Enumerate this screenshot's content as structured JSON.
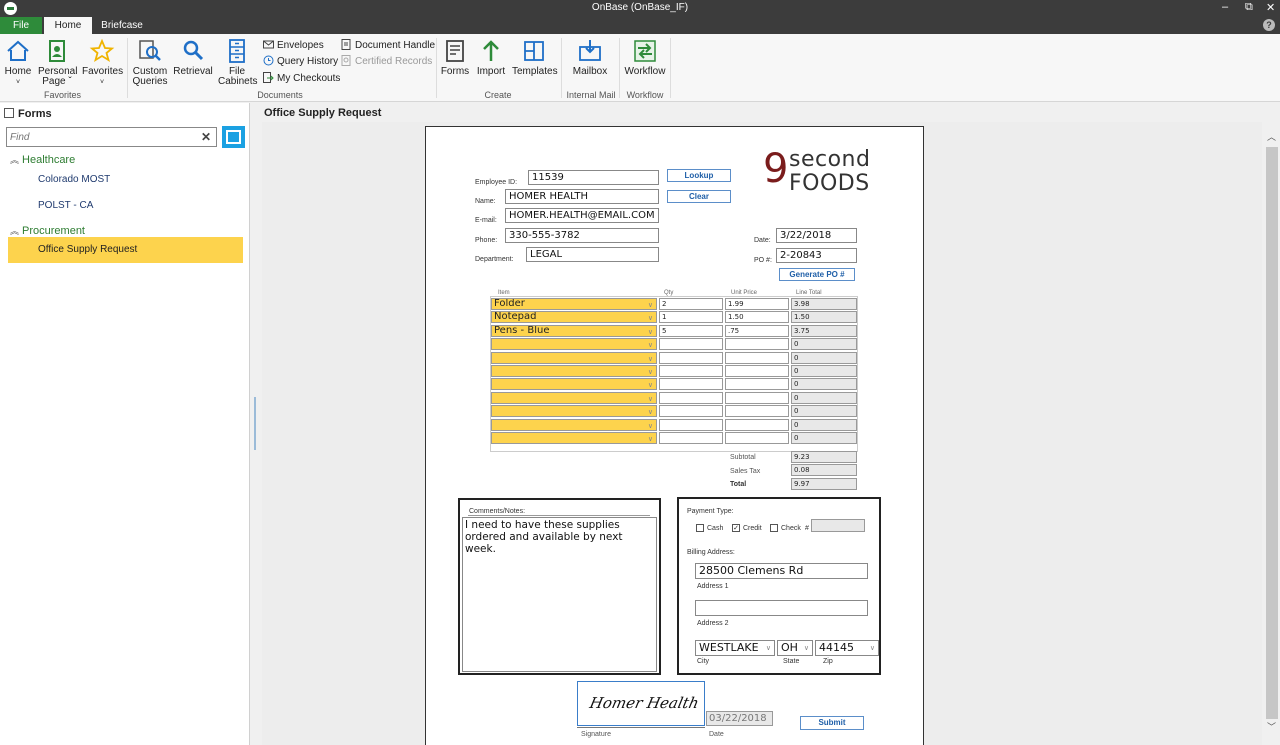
{
  "window": {
    "title": "OnBase (OnBase_IF)",
    "minimize": "–",
    "restore": "⧉",
    "close": "✕",
    "help": "?"
  },
  "tabs": [
    "File",
    "Home",
    "Briefcase"
  ],
  "ribbon": {
    "favorites": {
      "home": "Home",
      "personal_page_1": "Personal",
      "personal_page_2": "Page ˇ",
      "favorites": "Favorites",
      "group": "Favorites"
    },
    "documents": {
      "custom_queries_1": "Custom",
      "custom_queries_2": "Queries",
      "retrieval": "Retrieval",
      "file_cabinets_1": "File",
      "file_cabinets_2": "Cabinets",
      "envelopes": "Envelopes",
      "query_history": "Query History",
      "my_checkouts": "My Checkouts",
      "document_handle": "Document Handle",
      "certified_records": "Certified Records",
      "group": "Documents"
    },
    "create": {
      "forms": "Forms",
      "import": "Import",
      "templates": "Templates",
      "group": "Create"
    },
    "internal_mail": {
      "mailbox": "Mailbox",
      "group": "Internal Mail"
    },
    "workflow": {
      "workflow": "Workflow",
      "group": "Workflow"
    }
  },
  "sidebar": {
    "title": "Forms",
    "find_placeholder": "Find",
    "categories": [
      {
        "label": "Healthcare",
        "items": [
          "Colorado MOST",
          "POLST - CA"
        ]
      },
      {
        "label": "Procurement",
        "items": [
          "Office Supply Request"
        ]
      }
    ]
  },
  "main": {
    "title": "Office Supply Request"
  },
  "form": {
    "brand": {
      "line1": "second",
      "line2": "FOODS",
      "digit": "9"
    },
    "labels": {
      "employee_id": "Employee ID:",
      "name": "Name:",
      "email": "E-mail:",
      "phone": "Phone:",
      "department": "Department:",
      "date": "Date:",
      "po": "PO #:"
    },
    "values": {
      "employee_id": "11539",
      "name": "HOMER HEALTH",
      "email": "HOMER.HEALTH@EMAIL.COM",
      "phone": "330-555-3782",
      "department": "LEGAL",
      "date": "3/22/2018",
      "po": "2-20843"
    },
    "buttons": {
      "lookup": "Lookup",
      "clear": "Clear",
      "generate_po": "Generate PO #",
      "submit": "Submit"
    },
    "table": {
      "headers": [
        "Item",
        "Qty",
        "Unit Price",
        "Line Total"
      ],
      "rows": [
        {
          "item": "Folder",
          "qty": "2",
          "price": "1.99",
          "total": "3.98"
        },
        {
          "item": "Notepad",
          "qty": "1",
          "price": "1.50",
          "total": "1.50"
        },
        {
          "item": "Pens - Blue",
          "qty": "5",
          "price": ".75",
          "total": "3.75"
        },
        {
          "item": "",
          "qty": "",
          "price": "",
          "total": "0"
        },
        {
          "item": "",
          "qty": "",
          "price": "",
          "total": "0"
        },
        {
          "item": "",
          "qty": "",
          "price": "",
          "total": "0"
        },
        {
          "item": "",
          "qty": "",
          "price": "",
          "total": "0"
        },
        {
          "item": "",
          "qty": "",
          "price": "",
          "total": "0"
        },
        {
          "item": "",
          "qty": "",
          "price": "",
          "total": "0"
        },
        {
          "item": "",
          "qty": "",
          "price": "",
          "total": "0"
        },
        {
          "item": "",
          "qty": "",
          "price": "",
          "total": "0"
        }
      ],
      "subtotal_label": "Subtotal",
      "subtotal": "9.23",
      "tax_label": "Sales Tax",
      "tax": "0.08",
      "total_label": "Total",
      "total": "9.97"
    },
    "comments": {
      "label": "Comments/Notes:",
      "text": "I need to have these supplies ordered and available by next week."
    },
    "payment": {
      "label": "Payment Type:",
      "cash": "Cash",
      "credit": "Credit",
      "check": "Check",
      "check_no_label": "#",
      "check_mark": "✓",
      "billing_label": "Billing Address:",
      "address1": "28500 Clemens Rd",
      "address1_label": "Address 1",
      "address2": "",
      "address2_label": "Address 2",
      "city": "WESTLAKE",
      "city_label": "City",
      "state": "OH",
      "state_label": "State",
      "zip": "44145",
      "zip_label": "Zip"
    },
    "signature": {
      "text": "Homer Health",
      "label": "Signature",
      "date": "03/22/2018",
      "date_label": "Date"
    }
  }
}
